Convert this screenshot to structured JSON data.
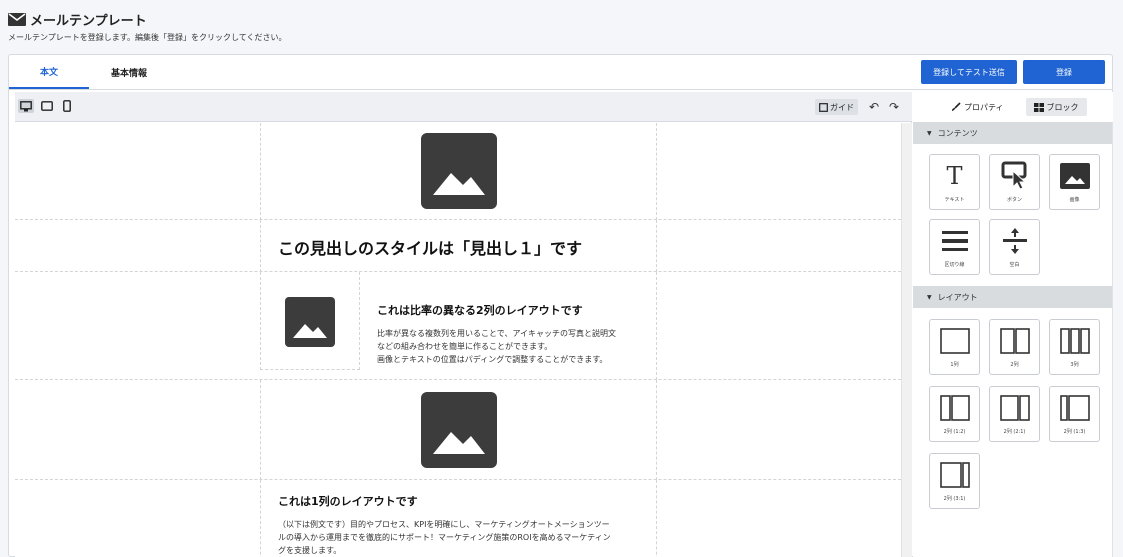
{
  "page": {
    "title": "メールテンプレート",
    "subtitle": "メールテンプレートを登録します。編集後「登録」をクリックしてください。"
  },
  "tabs": [
    {
      "label": "本文",
      "active": true
    },
    {
      "label": "基本情報",
      "active": false
    }
  ],
  "actions": {
    "test_send": "登録してテスト送信",
    "register": "登録"
  },
  "editor_toolbar": {
    "guide": "ガイド",
    "devices": [
      "desktop-icon",
      "tablet-icon",
      "mobile-icon"
    ]
  },
  "canvas": {
    "heading1": "この見出しのスタイルは「見出し１」です",
    "two_col_heading": "これは比率の異なる2列のレイアウトです",
    "two_col_body": [
      "比率が異なる複数列を用いることで、アイキャッチの写真と説明文",
      "などの組み合わせを簡単に作ることができます。",
      "画像とテキストの位置はパディングで調整することができます。"
    ],
    "one_col_heading": "これは1列のレイアウトです",
    "one_col_body": [
      "（以下は例文です）目的やプロセス、KPIを明確にし、マーケティングオートメーションツー",
      "ルの導入から運用までを徹底的にサポート！マーケティング施策のROIを高めるマーケティン",
      "グを支援します。"
    ]
  },
  "sidebar": {
    "tabs": [
      {
        "label": "プロパティ",
        "active": false
      },
      {
        "label": "ブロック",
        "active": true
      }
    ],
    "sections": {
      "contents": {
        "title": "コンテンツ",
        "items": [
          "テキスト",
          "ボタン",
          "画像",
          "区切り線",
          "空白"
        ]
      },
      "layout": {
        "title": "レイアウト",
        "items": [
          "1列",
          "2列",
          "3列",
          "2列 (1:2)",
          "2列 (2:1)",
          "2列 (1:3)",
          "2列 (3:1)"
        ]
      }
    }
  },
  "colors": {
    "primary": "#1f64d2",
    "placeholder": "#3c3c3c",
    "section_header": "#d9dcdf"
  }
}
